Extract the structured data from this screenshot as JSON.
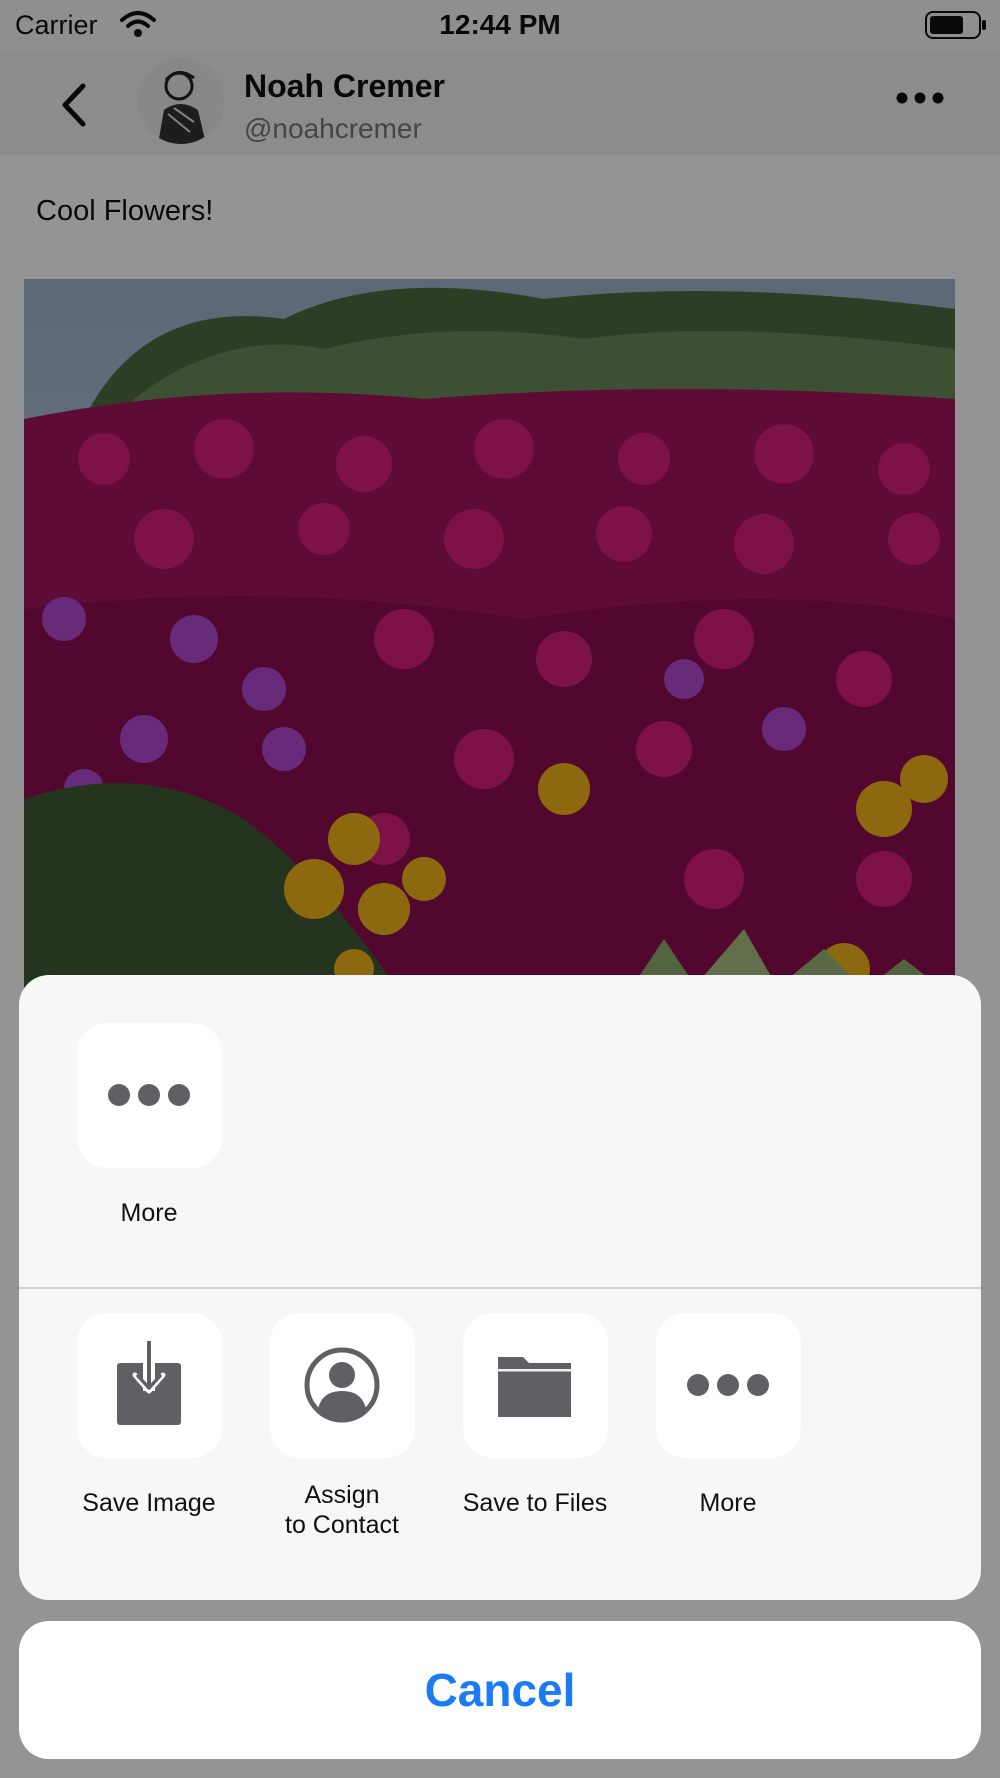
{
  "status": {
    "carrier": "Carrier",
    "time": "12:44 PM"
  },
  "profile": {
    "name": "Noah Cremer",
    "handle": "@noahcremer"
  },
  "post": {
    "text": "Cool Flowers!"
  },
  "share_sheet": {
    "top_row": [
      {
        "label": "More",
        "icon": "more-dots-icon"
      }
    ],
    "bottom_row": [
      {
        "label": "Save Image",
        "icon": "save-image-icon"
      },
      {
        "label": "Assign\nto Contact",
        "icon": "contact-icon"
      },
      {
        "label": "Save to Files",
        "icon": "folder-icon"
      },
      {
        "label": "More",
        "icon": "more-dots-icon"
      }
    ],
    "cancel_label": "Cancel"
  },
  "colors": {
    "accent": "#1a7bf2",
    "icon": "#5f5f64"
  }
}
